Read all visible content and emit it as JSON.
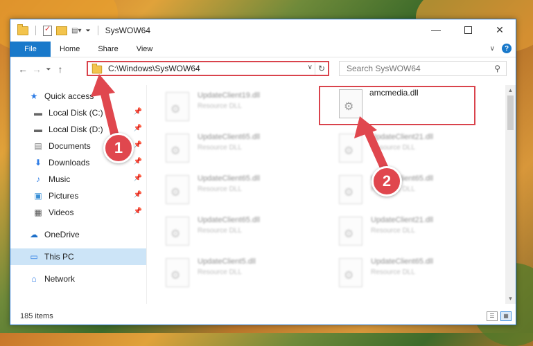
{
  "window": {
    "title": "SysWOW64"
  },
  "ribbon": {
    "tabs": [
      "File",
      "Home",
      "Share",
      "View"
    ]
  },
  "address": {
    "path": "C:\\Windows\\SysWOW64"
  },
  "search": {
    "placeholder": "Search SysWOW64"
  },
  "nav": {
    "items": [
      {
        "label": "Quick access",
        "icon": "star-icon",
        "pinned": false
      },
      {
        "label": "Local Disk (C:)",
        "icon": "drive-icon",
        "pinned": true
      },
      {
        "label": "Local Disk (D:)",
        "icon": "drive-icon",
        "pinned": true
      },
      {
        "label": "Documents",
        "icon": "documents-icon",
        "pinned": true
      },
      {
        "label": "Downloads",
        "icon": "download-icon",
        "pinned": true
      },
      {
        "label": "Music",
        "icon": "music-icon",
        "pinned": true
      },
      {
        "label": "Pictures",
        "icon": "pictures-icon",
        "pinned": true
      },
      {
        "label": "Videos",
        "icon": "videos-icon",
        "pinned": true
      },
      {
        "label": "OneDrive",
        "icon": "cloud-icon",
        "pinned": false
      },
      {
        "label": "This PC",
        "icon": "computer-icon",
        "pinned": false
      },
      {
        "label": "Network",
        "icon": "network-icon",
        "pinned": false
      }
    ]
  },
  "files": [
    {
      "name": "UpdateClient19.dll",
      "type": "Resource DLL"
    },
    {
      "name": "amcmedia.dll",
      "type": ""
    },
    {
      "name": "UpdateClient65.dll",
      "type": "Resource DLL"
    },
    {
      "name": "UpdateClient21.dll",
      "type": "Resource DLL"
    },
    {
      "name": "UpdateClient65.dll",
      "type": "Resource DLL"
    },
    {
      "name": "UpdateClient65.dll",
      "type": "Resource DLL"
    },
    {
      "name": "UpdateClient65.dll",
      "type": "Resource DLL"
    },
    {
      "name": "UpdateClient21.dll",
      "type": "Resource DLL"
    },
    {
      "name": "UpdateClient5.dll",
      "type": "Resource DLL"
    },
    {
      "name": "UpdateClient65.dll",
      "type": "Resource DLL"
    }
  ],
  "status": {
    "item_count": "185 items"
  },
  "annotations": {
    "badge1": "1",
    "badge2": "2"
  },
  "colors": {
    "highlight": "#d9434c",
    "accent": "#1979ca"
  }
}
